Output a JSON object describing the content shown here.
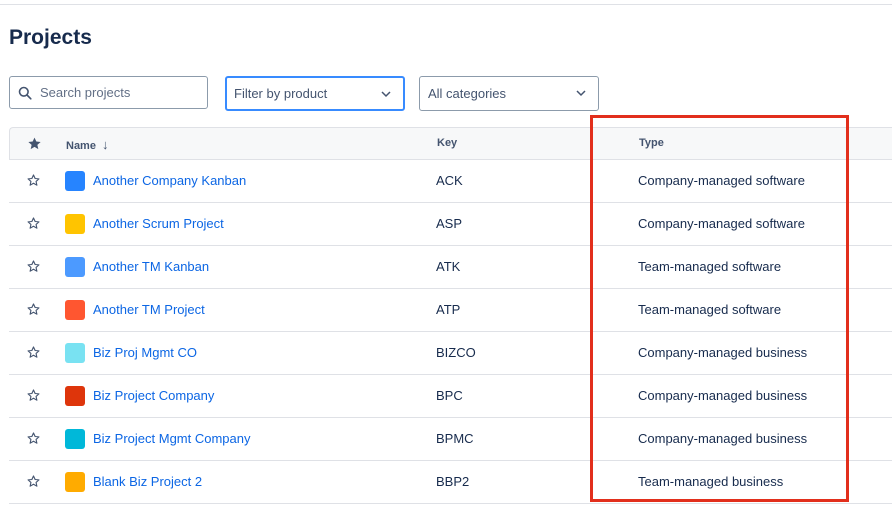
{
  "page": {
    "title": "Projects"
  },
  "filters": {
    "search_placeholder": "Search projects",
    "product_label": "Filter by product",
    "category_label": "All categories"
  },
  "table": {
    "columns": {
      "name": "Name",
      "key": "Key",
      "type": "Type"
    },
    "sort_indicator": "↓",
    "rows": [
      {
        "name": "Another Company Kanban",
        "key": "ACK",
        "type": "Company-managed software",
        "avatar_icon": "cloud-icon",
        "avatar_color": "#2684ff"
      },
      {
        "name": "Another Scrum Project",
        "key": "ASP",
        "type": "Company-managed software",
        "avatar_icon": "robot-icon",
        "avatar_color": "#ffc400"
      },
      {
        "name": "Another TM Kanban",
        "key": "ATK",
        "type": "Team-managed software",
        "avatar_icon": "koala-icon",
        "avatar_color": "#4c9aff"
      },
      {
        "name": "Another TM Project",
        "key": "ATP",
        "type": "Team-managed software",
        "avatar_icon": "wrench-icon",
        "avatar_color": "#ff5630"
      },
      {
        "name": "Biz Proj Mgmt CO",
        "key": "BIZCO",
        "type": "Company-managed business",
        "avatar_icon": "person-icon",
        "avatar_color": "#79e2f2"
      },
      {
        "name": "Biz Project Company",
        "key": "BPC",
        "type": "Company-managed business",
        "avatar_icon": "vinyl-icon",
        "avatar_color": "#de350b"
      },
      {
        "name": "Biz Project Mgmt Company",
        "key": "BPMC",
        "type": "Company-managed business",
        "avatar_icon": "rocket-icon",
        "avatar_color": "#00b8d9"
      },
      {
        "name": "Blank Biz Project 2",
        "key": "BBP2",
        "type": "Team-managed business",
        "avatar_icon": "pencil-icon",
        "avatar_color": "#ffab00"
      }
    ]
  },
  "colors": {
    "link": "#0c66e4",
    "highlight": "#e22f1c",
    "header_bg": "#f7f8f9",
    "border": "#dfe1e6"
  }
}
